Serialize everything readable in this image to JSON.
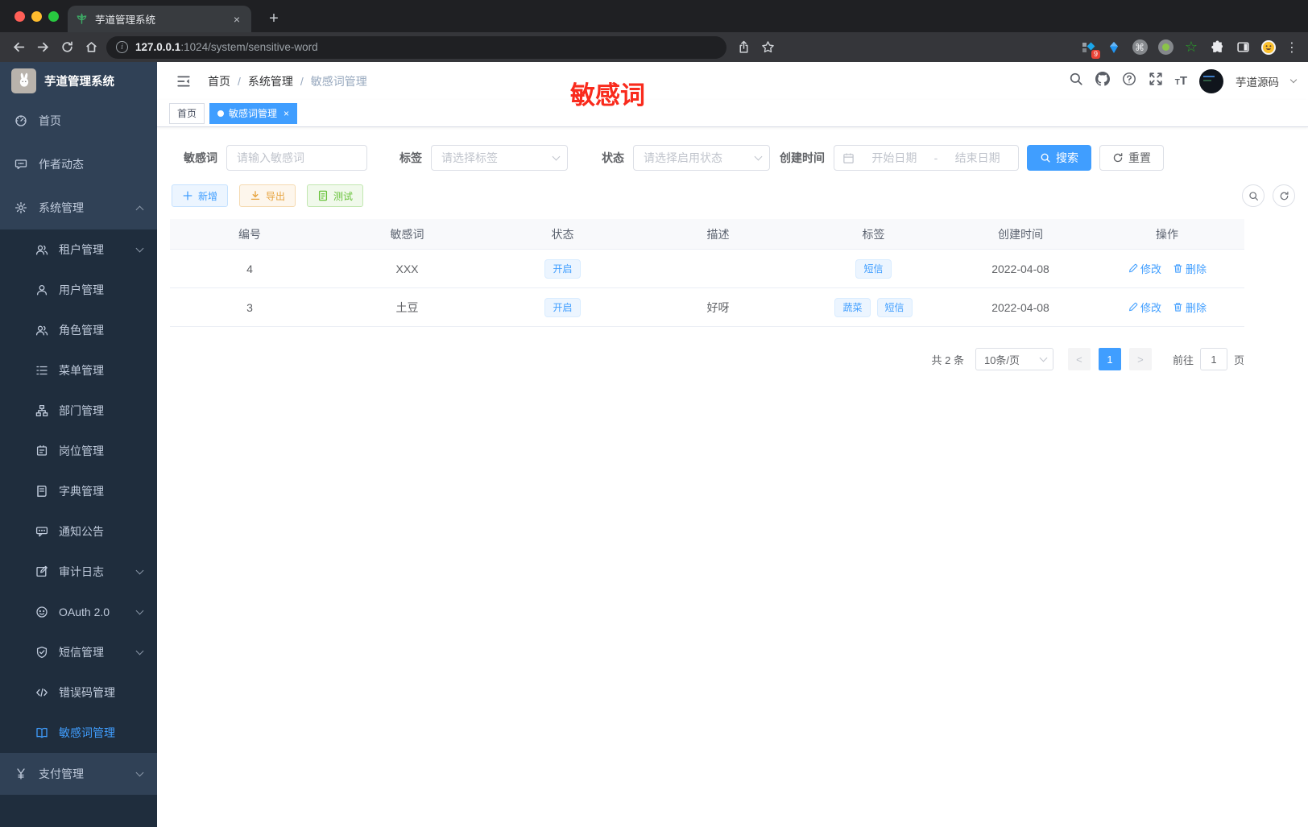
{
  "browser": {
    "tab_title": "芋道管理系统",
    "url_host": "127.0.0.1",
    "url_path": ":1024/system/sensitive-word",
    "ext_badge": "9"
  },
  "sidebar": {
    "app_title": "芋道管理系统",
    "items_top": [
      {
        "label": "首页",
        "icon": "dashboard-icon"
      },
      {
        "label": "作者动态",
        "icon": "message-icon"
      },
      {
        "label": "系统管理",
        "icon": "gear-icon",
        "expanded": true
      }
    ],
    "submenu": [
      {
        "label": "租户管理",
        "icon": "tenant-icon",
        "has_children": true
      },
      {
        "label": "用户管理",
        "icon": "user-icon"
      },
      {
        "label": "角色管理",
        "icon": "role-icon"
      },
      {
        "label": "菜单管理",
        "icon": "menu-tree-icon"
      },
      {
        "label": "部门管理",
        "icon": "org-icon"
      },
      {
        "label": "岗位管理",
        "icon": "post-icon"
      },
      {
        "label": "字典管理",
        "icon": "dict-icon"
      },
      {
        "label": "通知公告",
        "icon": "notice-icon"
      },
      {
        "label": "审计日志",
        "icon": "log-icon",
        "has_children": true
      },
      {
        "label": "OAuth 2.0",
        "icon": "oauth-icon",
        "has_children": true
      },
      {
        "label": "短信管理",
        "icon": "sms-icon",
        "has_children": true
      },
      {
        "label": "错误码管理",
        "icon": "error-code-icon"
      },
      {
        "label": "敏感词管理",
        "icon": "sensitive-word-icon",
        "active": true
      }
    ],
    "items_bottom": [
      {
        "label": "支付管理",
        "icon": "pay-icon",
        "has_children": true
      }
    ]
  },
  "header": {
    "breadcrumb": [
      "首页",
      "系统管理",
      "敏感词管理"
    ],
    "watermark": "敏感词",
    "user_name": "芋道源码"
  },
  "tags_view": [
    {
      "label": "首页"
    },
    {
      "label": "敏感词管理",
      "active": true
    }
  ],
  "filter": {
    "keyword_label": "敏感词",
    "keyword_placeholder": "请输入敏感词",
    "tag_label": "标签",
    "tag_placeholder": "请选择标签",
    "status_label": "状态",
    "status_placeholder": "请选择启用状态",
    "date_label": "创建时间",
    "date_start_placeholder": "开始日期",
    "date_separator": "-",
    "date_end_placeholder": "结束日期",
    "search_label": "搜索",
    "reset_label": "重置"
  },
  "toolbar": {
    "add_label": "新增",
    "export_label": "导出",
    "test_label": "测试"
  },
  "table": {
    "columns": [
      "编号",
      "敏感词",
      "状态",
      "描述",
      "标签",
      "创建时间",
      "操作"
    ],
    "rows": [
      {
        "id": "4",
        "word": "XXX",
        "status": "开启",
        "desc": "",
        "tags": [
          "短信"
        ],
        "created": "2022-04-08"
      },
      {
        "id": "3",
        "word": "土豆",
        "status": "开启",
        "desc": "好呀",
        "tags": [
          "蔬菜",
          "短信"
        ],
        "created": "2022-04-08"
      }
    ],
    "edit_label": "修改",
    "delete_label": "删除"
  },
  "pagination": {
    "total": "共 2 条",
    "page_size": "10条/页",
    "page": "1",
    "goto_label": "前往",
    "goto_value": "1",
    "page_unit": "页"
  },
  "colors": {
    "primary": "#409eff",
    "watermark_red": "#f92b1d",
    "warning": "#e6a23c",
    "success": "#67c23a",
    "sidebar_bg": "#304156",
    "submenu_bg": "#1f2d3d"
  }
}
